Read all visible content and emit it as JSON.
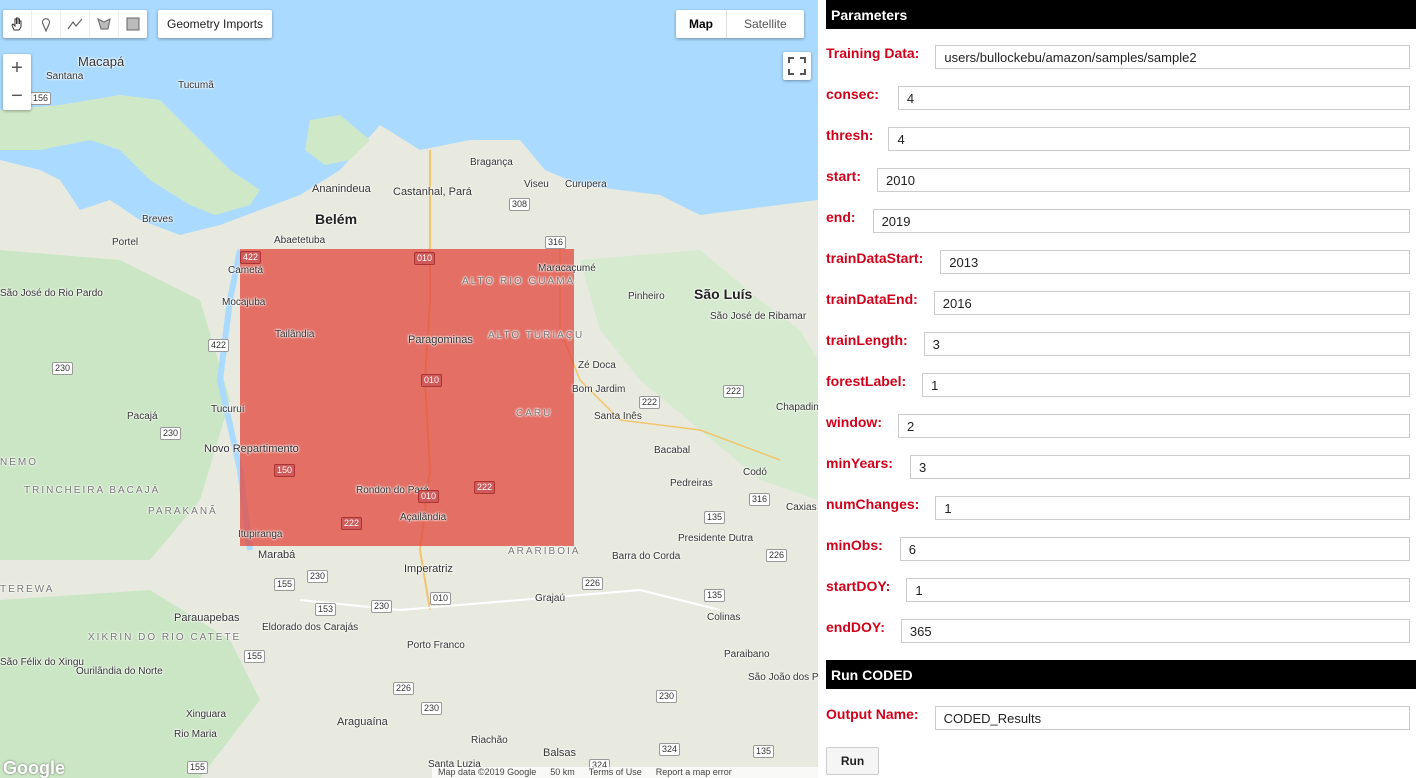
{
  "map": {
    "geometry_imports_label": "Geometry Imports",
    "map_type_map": "Map",
    "map_type_satellite": "Satellite",
    "zoom_in": "+",
    "zoom_out": "−",
    "google_logo": "Google",
    "attribution": {
      "map_data": "Map data ©2019 Google",
      "scale": "50 km",
      "terms": "Terms of Use",
      "report": "Report a map error"
    },
    "places_big": [
      "Belém",
      "São Luís"
    ],
    "places": [
      "Macapá",
      "Santana",
      "Tucumã",
      "Breves",
      "Portel",
      "Ananindeua",
      "Castanhal, Pará",
      "Bragança",
      "Viseu",
      "Curupera",
      "Abaetetuba",
      "Cametá",
      "Maracaçumé",
      "São José do Rio Pardo",
      "Pinheiro",
      "Mocajuba",
      "São José de Ribamar",
      "Tailândia",
      "Paragominas",
      "Zé Doca",
      "Bom Jardim",
      "Pacajá",
      "Tucuruí",
      "Santa Inês",
      "Chapadinha",
      "Novo Repartimento",
      "Bacabal",
      "Codó",
      "Pedreiras",
      "Rondon do Pará",
      "Açailândia",
      "Caxias",
      "Presidente Dutra",
      "Itupiranga",
      "Marabá",
      "Imperatriz",
      "Barra do Corda",
      "Grajaú",
      "Parauapebas",
      "Eldorado dos Carajás",
      "Colinas",
      "Porto Franco",
      "Paraibano",
      "São Félix do Xingu",
      "Ourilândia do Norte",
      "São João dos Patos",
      "Xinguara",
      "Araguaína",
      "Rio Maria",
      "Balsas",
      "Riachão",
      "Santa Luzia"
    ],
    "regions": [
      "ALTO RIO GUAMÁ",
      "ALTO TURIAÇU",
      "CARU",
      "TRINCHEIRA BACAJÁ",
      "PARAKANÃ",
      "ARARIBOIA",
      "XIKRIN DO RIO CATETE",
      "NEMO",
      "TEREWA"
    ],
    "shields": [
      "156",
      "422",
      "010",
      "316",
      "308",
      "230",
      "422",
      "010",
      "222",
      "222",
      "230",
      "150",
      "010",
      "222",
      "222",
      "316",
      "135",
      "226",
      "155",
      "230",
      "153",
      "230",
      "010",
      "226",
      "135",
      "155",
      "226",
      "230",
      "230",
      "324",
      "135",
      "155",
      "324"
    ],
    "tools": [
      "hand-icon",
      "point-icon",
      "line-icon",
      "polygon-icon",
      "rectangle-icon"
    ],
    "polygon_color": "#e24c42",
    "water_color": "#aadaff"
  },
  "panel": {
    "parameters_title": "Parameters",
    "fields": [
      {
        "label": "Training Data:",
        "value": "users/bullockebu/amazon/samples/sample2"
      },
      {
        "label": "consec:",
        "value": "4"
      },
      {
        "label": "thresh:",
        "value": "4"
      },
      {
        "label": "start:",
        "value": "2010"
      },
      {
        "label": "end:",
        "value": "2019"
      },
      {
        "label": "trainDataStart:",
        "value": "2013"
      },
      {
        "label": "trainDataEnd:",
        "value": "2016"
      },
      {
        "label": "trainLength:",
        "value": "3"
      },
      {
        "label": "forestLabel:",
        "value": "1"
      },
      {
        "label": "window:",
        "value": "2"
      },
      {
        "label": "minYears:",
        "value": "3"
      },
      {
        "label": "numChanges:",
        "value": "1"
      },
      {
        "label": "minObs:",
        "value": "6"
      },
      {
        "label": "startDOY:",
        "value": "1"
      },
      {
        "label": "endDOY:",
        "value": "365"
      }
    ],
    "run_title": "Run CODED",
    "output_label": "Output Name:",
    "output_value": "CODED_Results",
    "run_button": "Run",
    "label_color": "#d0021b"
  }
}
